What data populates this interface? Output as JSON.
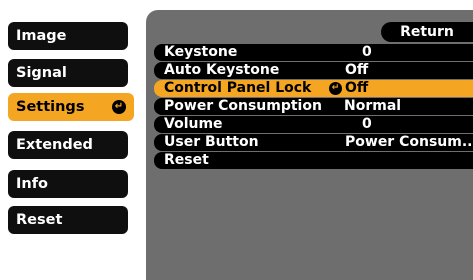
{
  "sidebar": {
    "items": [
      {
        "label": "Image"
      },
      {
        "label": "Signal"
      },
      {
        "label": "Settings"
      },
      {
        "label": "Extended"
      },
      {
        "label": "Info"
      },
      {
        "label": "Reset"
      }
    ],
    "active_enter_icon": "↵"
  },
  "panel": {
    "return_label": "Return",
    "rows": [
      {
        "label": "Keystone",
        "value": "0"
      },
      {
        "label": "Auto Keystone",
        "value": "Off"
      },
      {
        "label": "Control Panel Lock",
        "value": "Off"
      },
      {
        "label": "Power Consumption",
        "value": "Normal"
      },
      {
        "label": "Volume",
        "value": "0"
      },
      {
        "label": "User Button",
        "value": "Power Consum..."
      },
      {
        "label": "Reset",
        "value": ""
      }
    ],
    "enter_icon": "↵"
  },
  "colors": {
    "accent": "#f4a623",
    "panel_bg": "#6e6e6e",
    "item_bg": "#0f0f0f"
  },
  "icons": {
    "enter": "enter-icon",
    "return": "return-icon"
  }
}
